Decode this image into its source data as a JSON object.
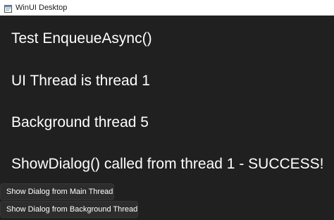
{
  "window": {
    "title": "WinUI Desktop"
  },
  "content": {
    "lines": [
      "Test EnqueueAsync()",
      "UI Thread is thread 1",
      "Background thread 5",
      "ShowDialog() called from thread 1 - SUCCESS!"
    ],
    "buttons": {
      "main_thread": "Show Dialog from Main Thread",
      "background_thread": "Show Dialog from Background Thread"
    }
  },
  "colors": {
    "background": "#202020",
    "titlebar": "#ffffff",
    "button": "#2d2d2d",
    "text": "#ffffff"
  }
}
